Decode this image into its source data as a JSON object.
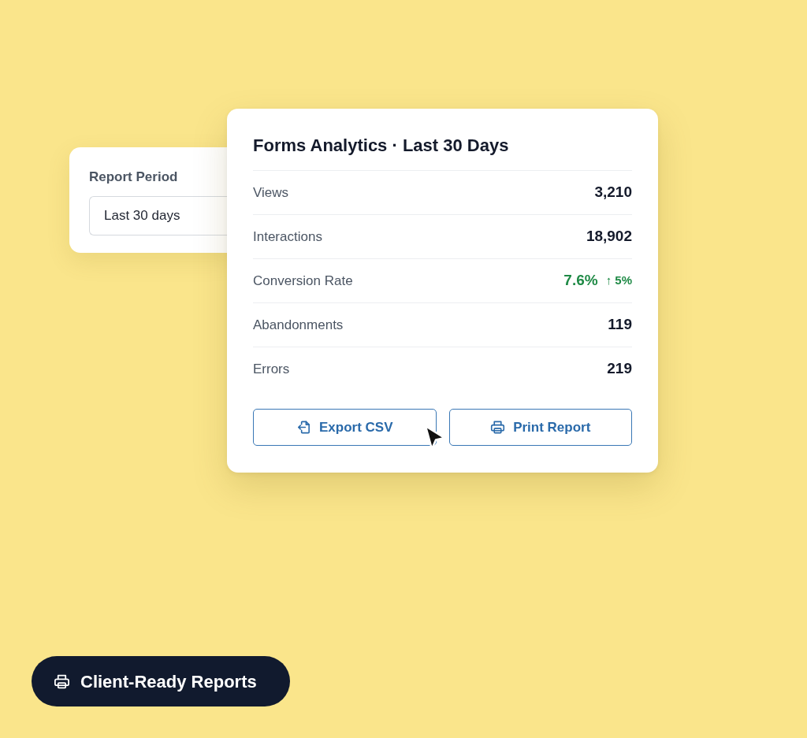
{
  "period_panel": {
    "label": "Report Period",
    "select_value": "Last 30 days"
  },
  "analytics_card": {
    "title": "Forms Analytics · Last 30 Days",
    "metrics": [
      {
        "kind": "plain",
        "label": "Views",
        "value": "3,210"
      },
      {
        "kind": "plain",
        "label": "Interactions",
        "value": "18,902"
      },
      {
        "kind": "trend",
        "label": "Conversion Rate",
        "value": "7.6%",
        "change": "↑ 5%"
      },
      {
        "kind": "plain",
        "label": "Abandonments",
        "value": "119"
      },
      {
        "kind": "plain",
        "label": "Errors",
        "value": "219"
      }
    ],
    "buttons": [
      {
        "kind": "export",
        "label": "Export CSV"
      },
      {
        "kind": "print",
        "label": "Print Report"
      }
    ]
  },
  "feature_pill": {
    "kind": "print",
    "label": "Client-Ready Reports"
  }
}
